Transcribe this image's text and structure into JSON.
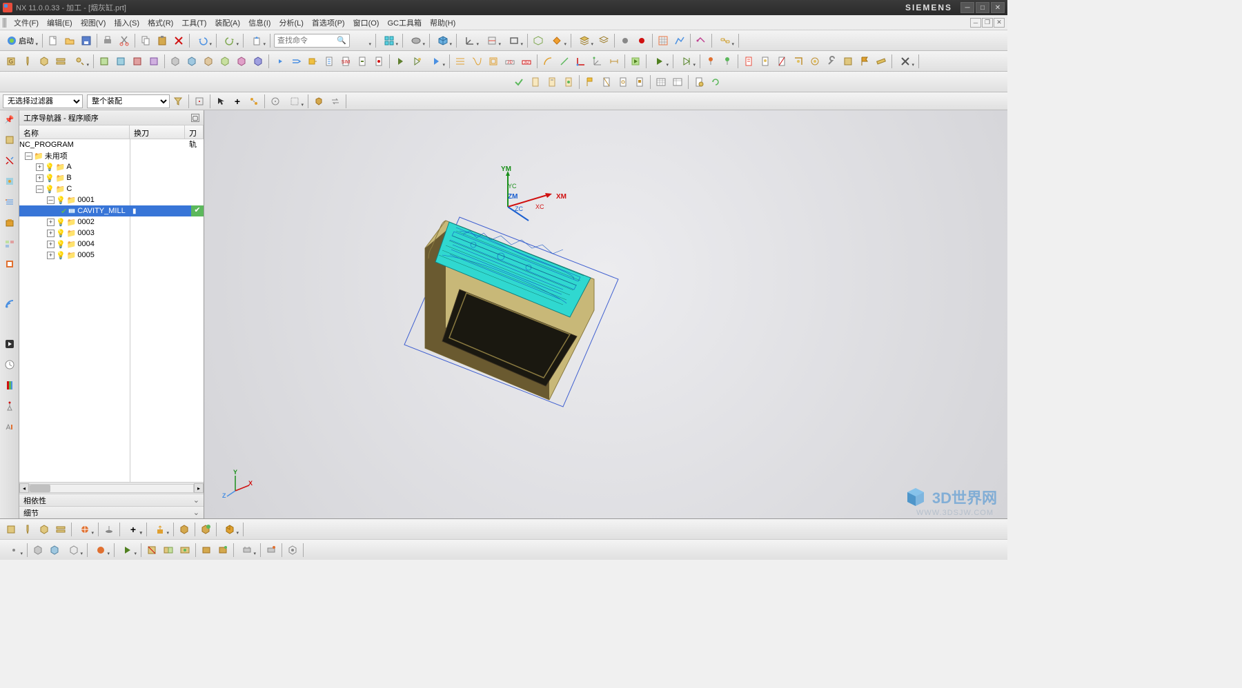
{
  "title": "NX 11.0.0.33 - 加工 - [烟灰缸.prt]",
  "brand": "SIEMENS",
  "menus": [
    "文件(F)",
    "编辑(E)",
    "视图(V)",
    "插入(S)",
    "格式(R)",
    "工具(T)",
    "装配(A)",
    "信息(I)",
    "分析(L)",
    "首选项(P)",
    "窗口(O)",
    "GC工具箱",
    "帮助(H)"
  ],
  "start_btn": "启动",
  "search_placeholder": "查找命令",
  "filter1": "无选择过滤器",
  "filter2": "整个装配",
  "nav_title": "工序导航器 - 程序顺序",
  "nav_cols": {
    "name": "名称",
    "tool": "换刀",
    "cut": "刀轨"
  },
  "tree": {
    "root": "NC_PROGRAM",
    "unused": "未用项",
    "a": "A",
    "b": "B",
    "c": "C",
    "p1": "0001",
    "cavity": "CAVITY_MILL",
    "p2": "0002",
    "p3": "0003",
    "p4": "0004",
    "p5": "0005"
  },
  "subpanel1": "相依性",
  "subpanel2": "细节",
  "axes": {
    "xm": "XM",
    "ym": "YM",
    "zm": "ZM",
    "xc": "XC",
    "yc": "YC",
    "zc": "ZC"
  },
  "triad": {
    "x": "X",
    "y": "Y",
    "z": "Z"
  },
  "watermark": "3D世界网",
  "watermark_sub": "WWW.3DSJW.COM"
}
